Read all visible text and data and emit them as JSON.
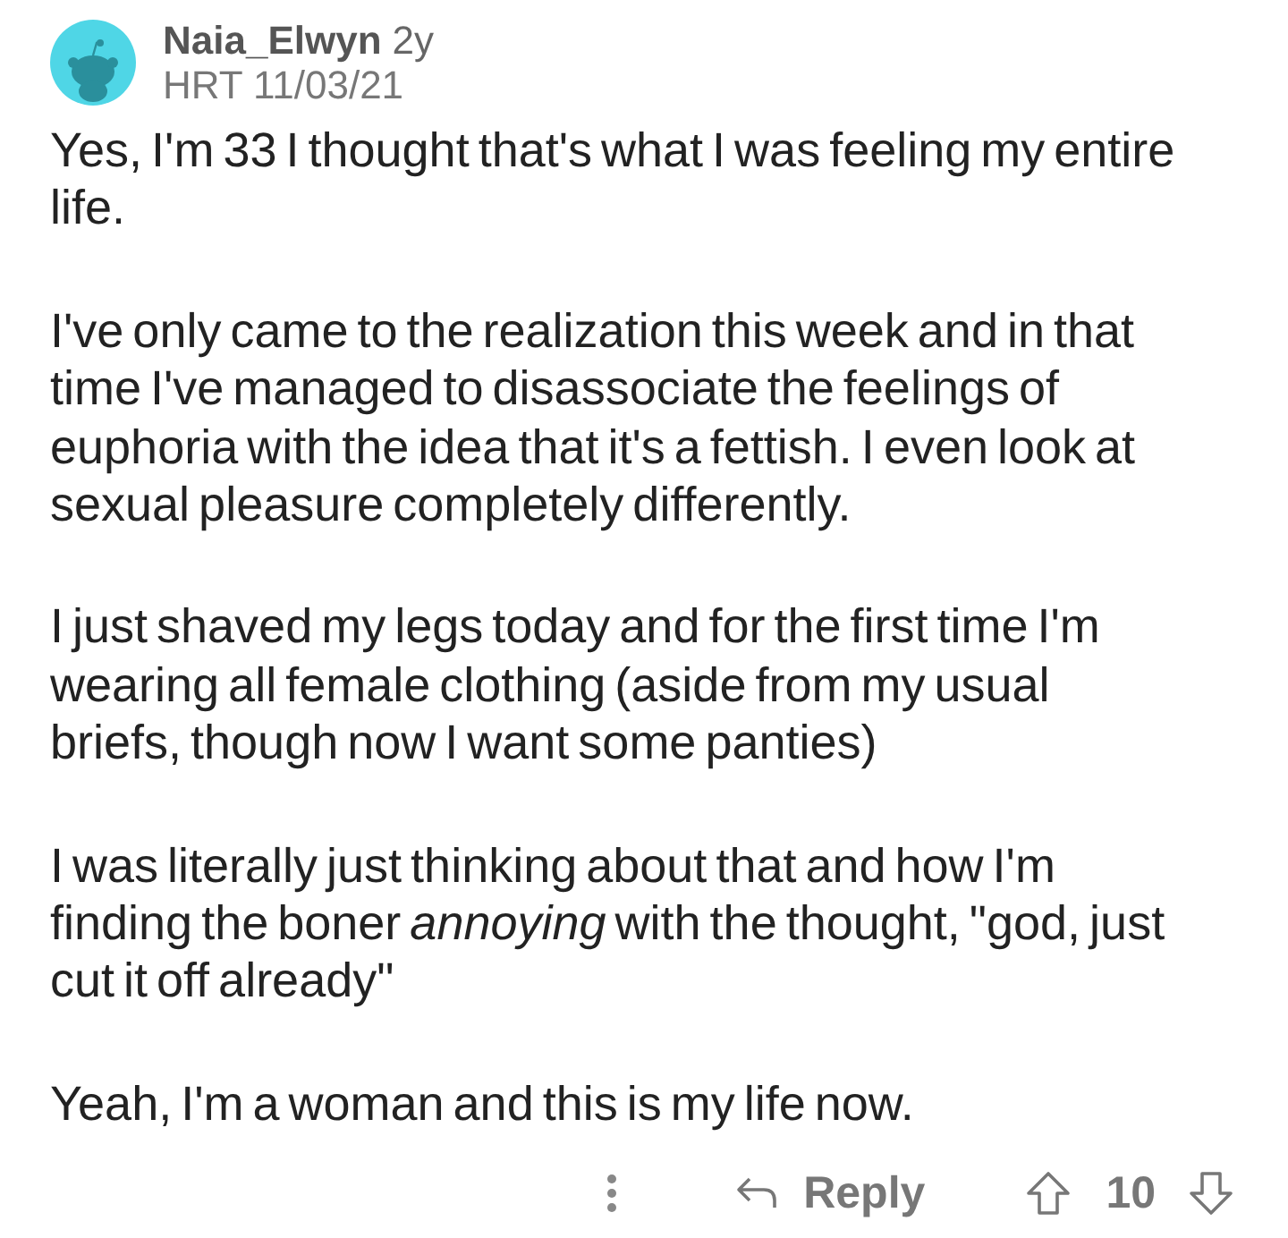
{
  "comment": {
    "author": "Naia_Elwyn",
    "age": "2y",
    "flair": "HRT 11/03/21",
    "paragraphs": [
      "Yes, I'm 33 I thought that's what I was feeling my entire life.",
      "I've only came to the realization this week and in that time I've managed to disassociate the feelings of euphoria with the idea that it's a fettish. I even look at sexual pleasure completely differently.",
      "I just shaved my legs today and for the first time I'm wearing all female clothing (aside from my usual briefs, though now I want some panties)",
      "I was literally just thinking about that and how I'm finding the boner *annoying* with the thought, \"god, just cut it off already\"",
      "Yeah, I'm a woman and this is my life now."
    ]
  },
  "actions": {
    "reply": "Reply",
    "score": "10"
  }
}
